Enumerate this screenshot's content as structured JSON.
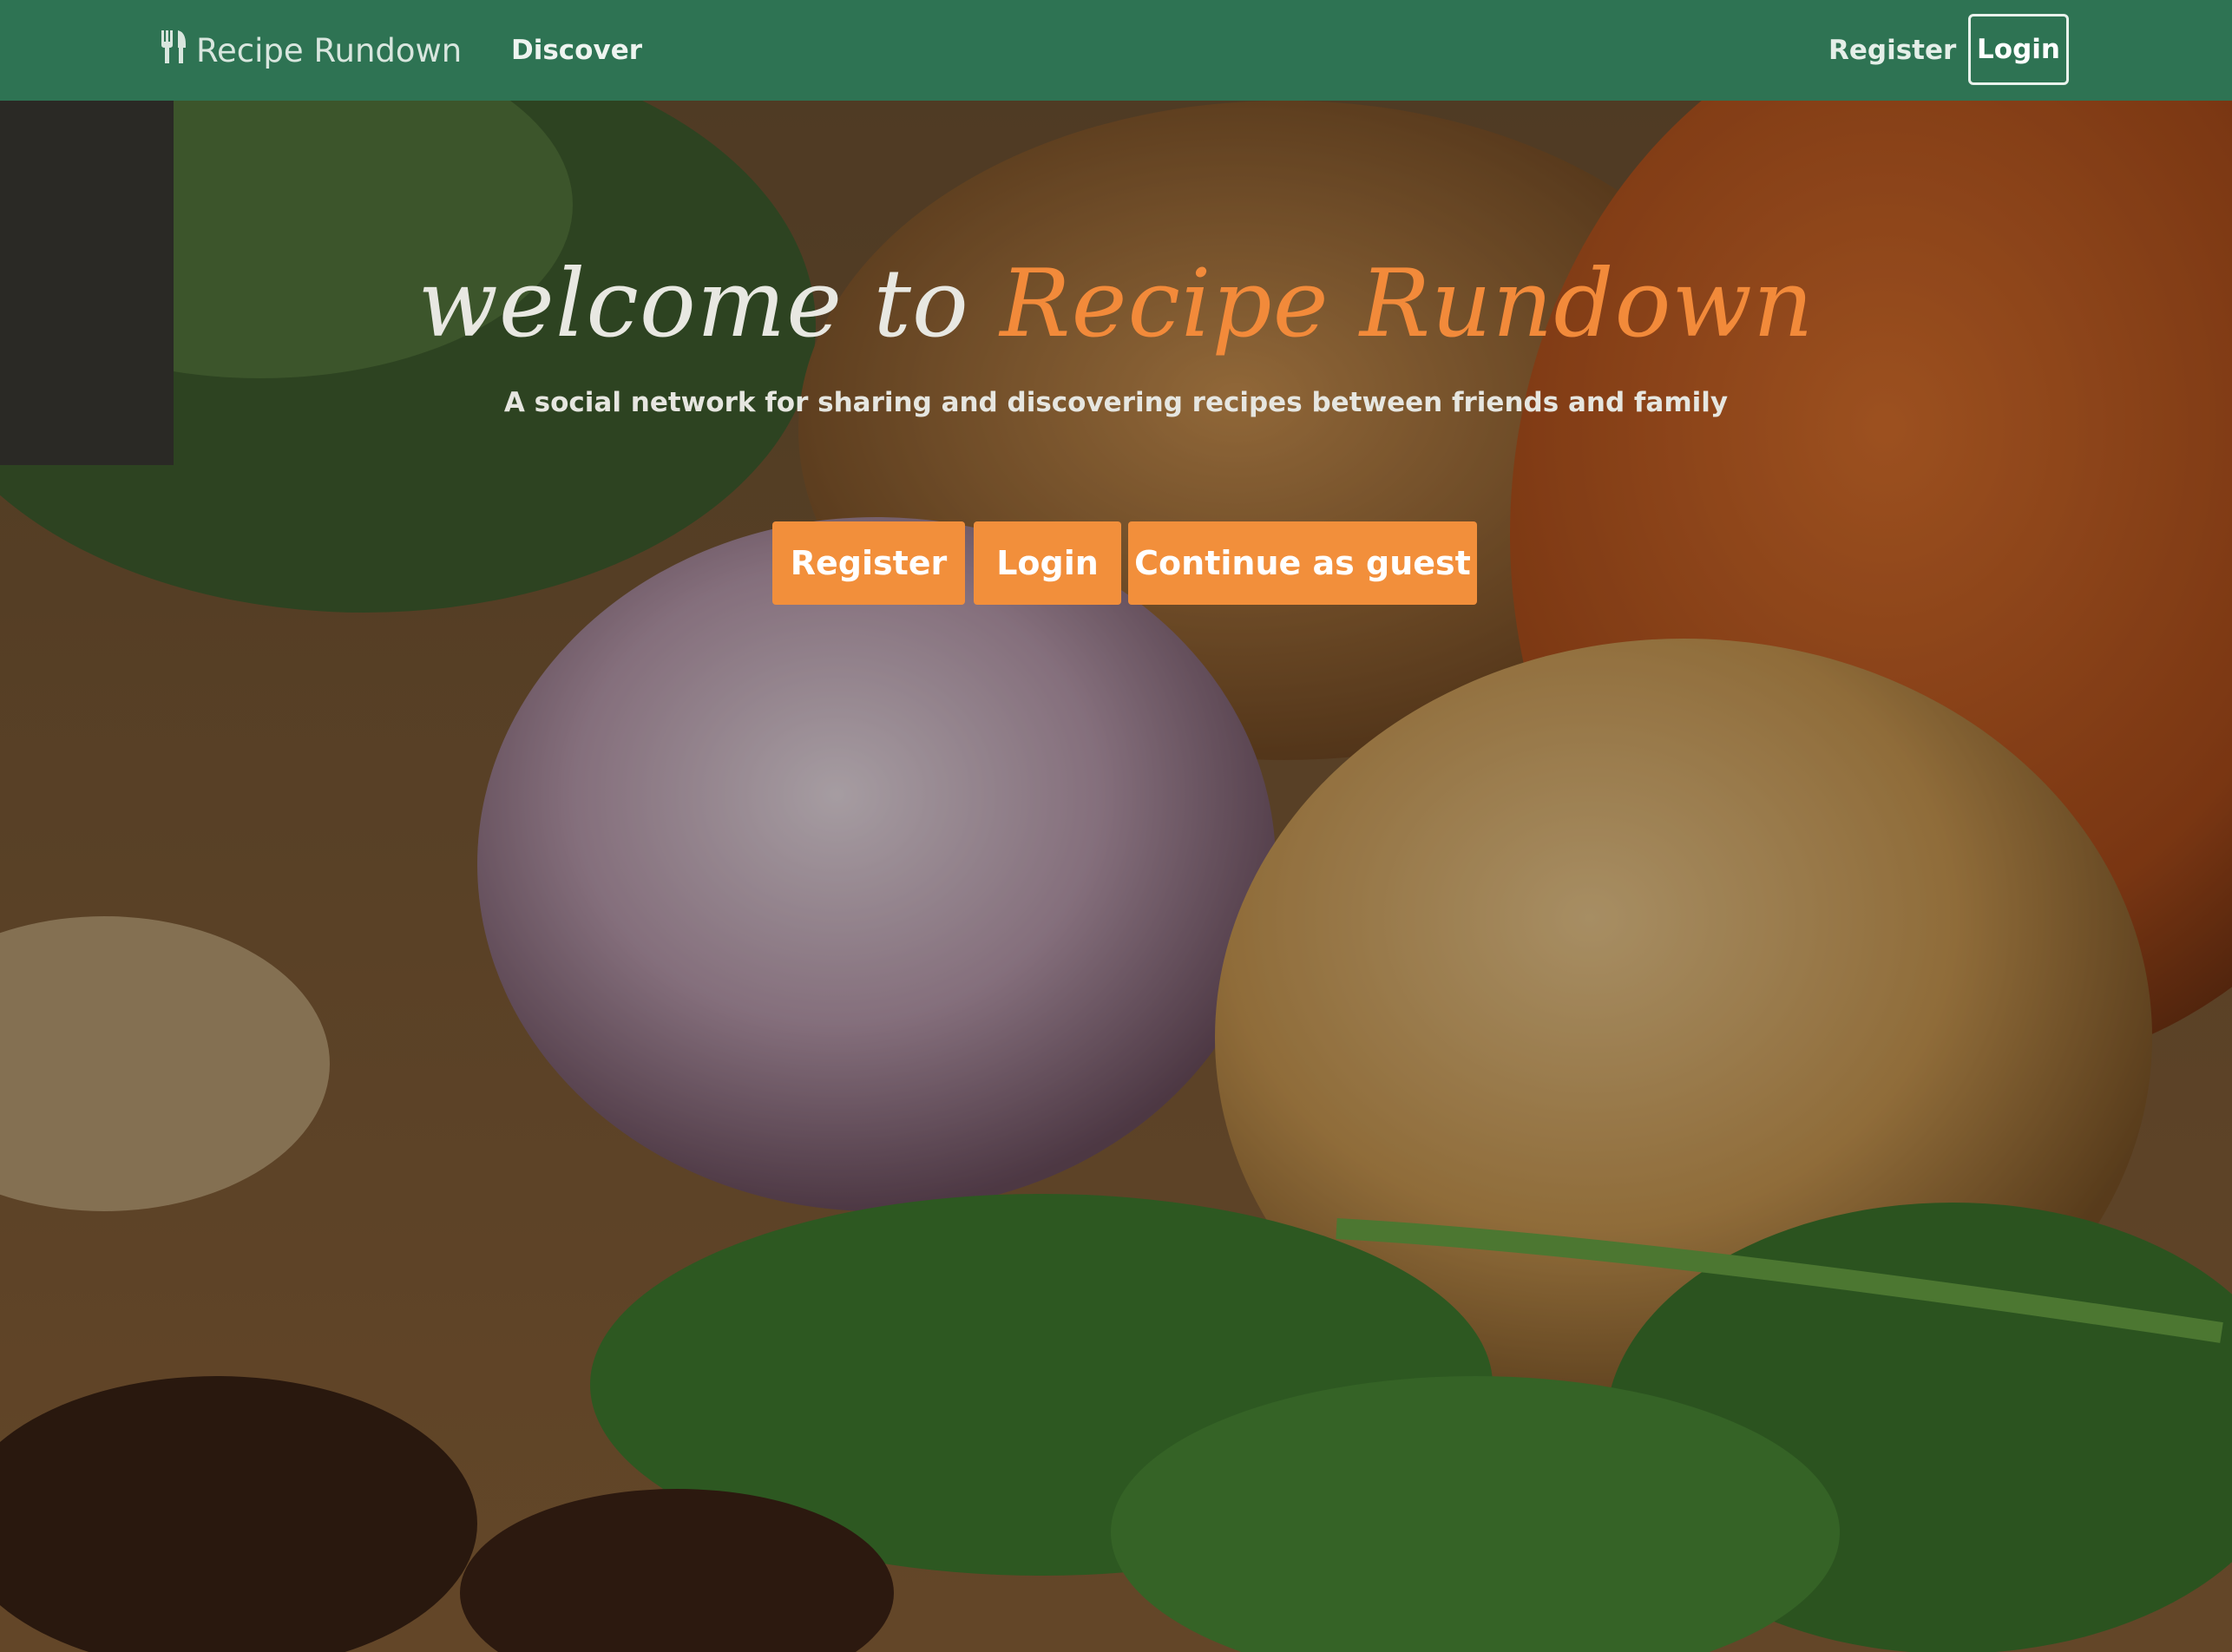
{
  "navbar": {
    "brand": "Recipe Rundown",
    "brand_icon": "fork-knife-icon",
    "discover": "Discover",
    "register": "Register",
    "login": "Login"
  },
  "hero": {
    "title_prefix": "welcome to",
    "title_accent": "Recipe Rundown",
    "subtitle": "A social network for sharing and discovering recipes between friends and family",
    "buttons": {
      "register": "Register",
      "login": "Login",
      "guest": "Continue as guest"
    }
  },
  "colors": {
    "navbar_bg": "#2e7353",
    "accent": "#f28f3b",
    "title_text": "#e8e8e2"
  }
}
